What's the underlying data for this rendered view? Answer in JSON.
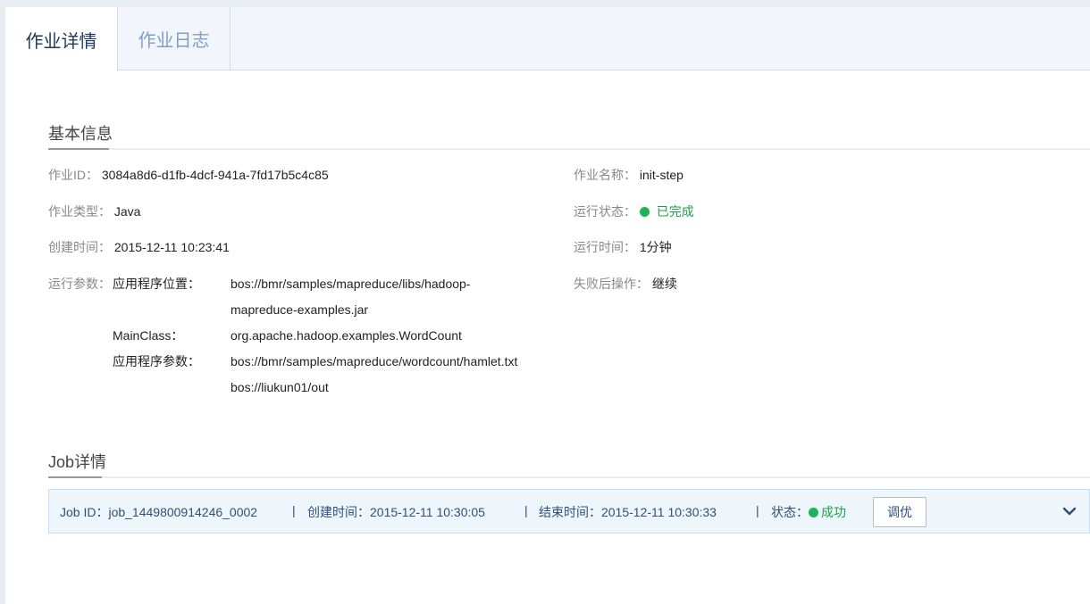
{
  "tabs": [
    {
      "label": "作业详情",
      "active": true
    },
    {
      "label": "作业日志",
      "active": false
    }
  ],
  "basic": {
    "title": "基本信息",
    "job_id_label": "作业ID：",
    "job_id": "3084a8d6-d1fb-4dcf-941a-7fd17b5c4c85",
    "job_name_label": "作业名称：",
    "job_name": "init-step",
    "type_label": "作业类型：",
    "type": "Java",
    "status_label": "运行状态：",
    "status": "已完成",
    "created_label": "创建时间：",
    "created": "2015-12-11 10:23:41",
    "runtime_label": "运行时间：",
    "runtime": "1分钟",
    "params_label": "运行参数：",
    "app_location_label": "应用程序位置：",
    "app_location_line1": "bos://bmr/samples/mapreduce/libs/hadoop-",
    "app_location_line2": "mapreduce-examples.jar",
    "mainclass_label": "MainClass：",
    "mainclass": "org.apache.hadoop.examples.WordCount",
    "app_args_label": "应用程序参数：",
    "app_args_line1": "bos://bmr/samples/mapreduce/wordcount/hamlet.txt",
    "app_args_line2": "bos://liukun01/out",
    "fail_action_label": "失败后操作：",
    "fail_action": "继续"
  },
  "job": {
    "title": "Job详情",
    "id_text": "Job ID：job_1449800914246_0002",
    "separator": "|",
    "created_text": "创建时间：2015-12-11 10:30:05",
    "ended_text": "结束时间：2015-12-11 10:30:33",
    "status_label": "状态：",
    "status": "成功",
    "tune_button": "调优",
    "expand_icon": "chevron-down-icon"
  },
  "colors": {
    "success": "#1aa04a",
    "link": "#2d4f7a",
    "tab_active": "#1f3a60",
    "tab_inactive": "#7fa0c5"
  }
}
